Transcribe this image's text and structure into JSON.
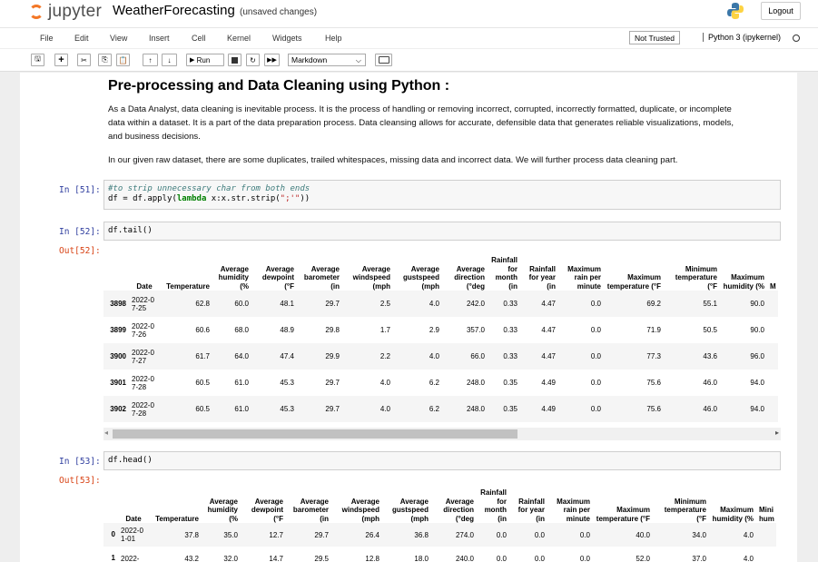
{
  "header": {
    "logo_text": "jupyter",
    "notebook_name": "WeatherForecasting",
    "save_status": "(unsaved changes)",
    "logout_label": "Logout"
  },
  "menu": {
    "items": [
      "File",
      "Edit",
      "View",
      "Insert",
      "Cell",
      "Kernel",
      "Widgets",
      "Help"
    ],
    "trust_label": "Not Trusted",
    "kernel_label": "Python 3 (ipykernel)"
  },
  "toolbar": {
    "run_label": "Run",
    "cell_type": "Markdown"
  },
  "markdown": {
    "heading": "Pre-processing and Data Cleaning using Python :",
    "para1": "As a Data Analyst, data cleaning is inevitable process. It is the process of handling or removing incorrect, corrupted, incorrectly formatted, duplicate, or incomplete data within a dataset. It is a part of the data preparation process. Data cleansing allows for accurate, defensible data that generates reliable visualizations, models, and business decisions.",
    "para2": "In our given raw dataset, there are some duplicates, trailed whitespaces, missing data and incorrect data. We will further process data cleaning part."
  },
  "cells": {
    "c51": {
      "prompt": "In [51]:",
      "comment": "#to strip unnecessary char from both ends",
      "code_a": "df = df.apply(",
      "code_kw": "lambda",
      "code_b": " x:x.str.strip(",
      "code_str": "\";'\"",
      "code_c": "))"
    },
    "c52": {
      "prompt": "In [52]:",
      "code": "df.tail()",
      "out_prompt": "Out[52]:"
    },
    "c53": {
      "prompt": "In [53]:",
      "code": "df.head()",
      "out_prompt": "Out[53]:"
    }
  },
  "tail_table": {
    "headers": [
      "",
      "Date",
      "Temperature",
      "Average humidity (%",
      "Average dewpoint (°F",
      "Average barometer (in",
      "Average windspeed (mph",
      "Average gustspeed (mph",
      "Average direction (°deg",
      "Rainfall for month (in",
      "Rainfall for year (in",
      "Maximum rain per minute",
      "Maximum temperature (°F",
      "Minimum temperature (°F",
      "Maximum humidity (%",
      "M"
    ],
    "rows": [
      [
        "3898",
        "2022-07-25",
        "62.8",
        "60.0",
        "48.1",
        "29.7",
        "2.5",
        "4.0",
        "242.0",
        "0.33",
        "4.47",
        "0.0",
        "69.2",
        "55.1",
        "90.0",
        ""
      ],
      [
        "3899",
        "2022-07-26",
        "60.6",
        "68.0",
        "48.9",
        "29.8",
        "1.7",
        "2.9",
        "357.0",
        "0.33",
        "4.47",
        "0.0",
        "71.9",
        "50.5",
        "90.0",
        ""
      ],
      [
        "3900",
        "2022-07-27",
        "61.7",
        "64.0",
        "47.4",
        "29.9",
        "2.2",
        "4.0",
        "66.0",
        "0.33",
        "4.47",
        "0.0",
        "77.3",
        "43.6",
        "96.0",
        ""
      ],
      [
        "3901",
        "2022-07-28",
        "60.5",
        "61.0",
        "45.3",
        "29.7",
        "4.0",
        "6.2",
        "248.0",
        "0.35",
        "4.49",
        "0.0",
        "75.6",
        "46.0",
        "94.0",
        ""
      ],
      [
        "3902",
        "2022-07-28",
        "60.5",
        "61.0",
        "45.3",
        "29.7",
        "4.0",
        "6.2",
        "248.0",
        "0.35",
        "4.49",
        "0.0",
        "75.6",
        "46.0",
        "94.0",
        ""
      ]
    ]
  },
  "head_table": {
    "headers": [
      "",
      "Date",
      "Temperature",
      "Average humidity (%",
      "Average dewpoint (°F",
      "Average barometer (in",
      "Average windspeed (mph",
      "Average gustspeed (mph",
      "Average direction (°deg",
      "Rainfall for month (in",
      "Rainfall for year (in",
      "Maximum rain per minute",
      "Maximum temperature (°F",
      "Minimum temperature (°F",
      "Maximum humidity (%",
      "Mini hum"
    ],
    "rows": [
      [
        "0",
        "2022-01-01",
        "37.8",
        "35.0",
        "12.7",
        "29.7",
        "26.4",
        "36.8",
        "274.0",
        "0.0",
        "0.0",
        "0.0",
        "40.0",
        "34.0",
        "4.0",
        ""
      ],
      [
        "1",
        "2022-",
        "43.2",
        "32.0",
        "14.7",
        "29.5",
        "12.8",
        "18.0",
        "240.0",
        "0.0",
        "0.0",
        "0.0",
        "52.0",
        "37.0",
        "4.0",
        ""
      ]
    ]
  }
}
